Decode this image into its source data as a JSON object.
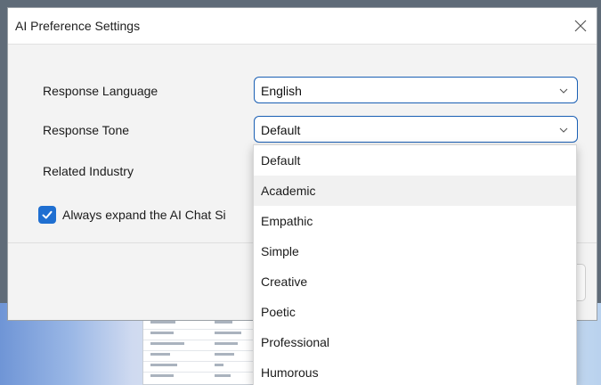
{
  "dialog": {
    "title": "AI Preference Settings",
    "close_icon": "close-icon"
  },
  "fields": {
    "response_language_label": "Response Language",
    "response_language_value": "English",
    "response_tone_label": "Response Tone",
    "response_tone_value": "Default",
    "related_industry_label": "Related Industry"
  },
  "checkbox": {
    "label": "Always expand the AI Chat Si",
    "checked": true
  },
  "tone_options": [
    "Default",
    "Academic",
    "Empathic",
    "Simple",
    "Creative",
    "Poetic",
    "Professional",
    "Humorous"
  ],
  "colors": {
    "accent": "#1f6fd1",
    "select_border": "#1a5fb4",
    "highlight": "#f1f1f1"
  }
}
